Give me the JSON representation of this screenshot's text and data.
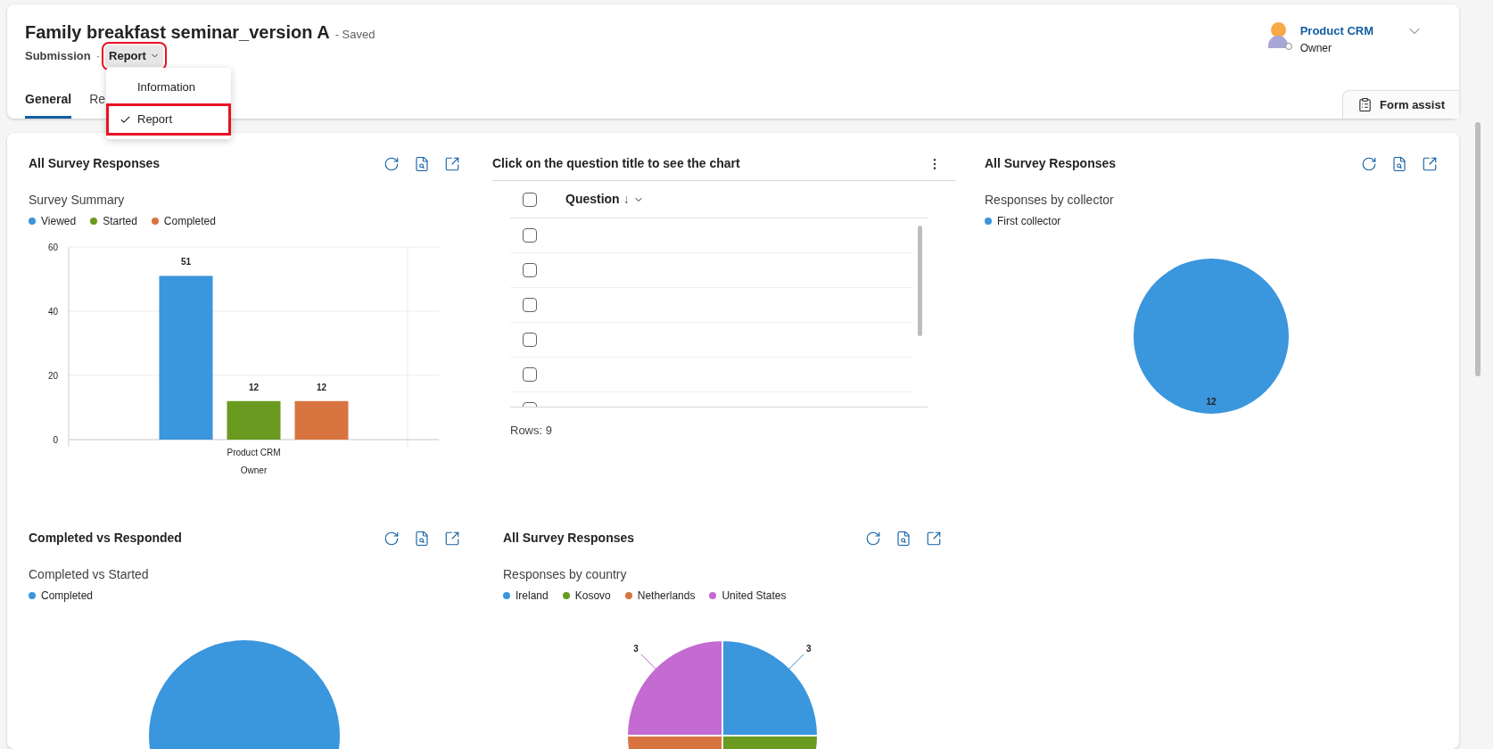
{
  "header": {
    "title": "Family breakfast seminar_version A",
    "save_status": "- Saved",
    "entity": "Submission",
    "separator": "·",
    "form_selector": {
      "label": "Report",
      "highlighted": true
    },
    "owner": {
      "name": "Product CRM",
      "role": "Owner"
    },
    "form_assist": "Form assist"
  },
  "tabs": [
    {
      "label": "General",
      "selected": true
    },
    {
      "label": "Re",
      "selected": false
    }
  ],
  "form_menu": [
    {
      "label": "Information",
      "selected": false,
      "highlighted": false
    },
    {
      "label": "Report",
      "selected": true,
      "highlighted": true
    }
  ],
  "tiles": [
    {
      "kind": "bar",
      "title": "All Survey Responses",
      "subtitle": "Survey Summary",
      "chart_data": {
        "type": "bar",
        "xlabel": "Owner",
        "categories": [
          "Product CRM"
        ],
        "series": [
          {
            "name": "Viewed",
            "color": "#3a96dd",
            "values": [
              51
            ]
          },
          {
            "name": "Started",
            "color": "#6a9a1f",
            "values": [
              12
            ]
          },
          {
            "name": "Completed",
            "color": "#d87440",
            "values": [
              12
            ]
          }
        ],
        "ylim": [
          0,
          60
        ],
        "yticks": [
          0,
          20,
          40,
          60
        ],
        "data_labels": true
      }
    },
    {
      "kind": "grid",
      "title": "Click on the question title to see the chart",
      "column": "Question",
      "sort_arrow": "↓",
      "select_all_checked": false,
      "rows": [
        {
          "checked": false
        },
        {
          "checked": false
        },
        {
          "checked": false
        },
        {
          "checked": false
        },
        {
          "checked": false
        },
        {
          "checked": false
        }
      ],
      "footer": "Rows: 9"
    },
    {
      "kind": "pie",
      "title": "All Survey Responses",
      "subtitle": "Responses by collector",
      "chart_data": {
        "type": "pie",
        "categories": [
          "First collector"
        ],
        "colors": [
          "#3a96dd"
        ],
        "series": [
          {
            "values": [
              12
            ]
          }
        ],
        "data_labels": true
      }
    },
    {
      "kind": "disc",
      "title": "Completed vs Responded",
      "subtitle": "Completed vs Started",
      "legend": [
        {
          "label": "Completed",
          "color": "#3a96dd"
        }
      ]
    },
    {
      "kind": "pie",
      "title": "All Survey Responses",
      "subtitle": "Responses by country",
      "chart_data": {
        "type": "pie",
        "categories": [
          "Ireland",
          "Kosovo",
          "Netherlands",
          "United States"
        ],
        "colors": [
          "#3a96dd",
          "#6a9a1f",
          "#d87440",
          "#c36bd1"
        ],
        "series": [
          {
            "values": [
              25,
              25,
              25,
              25
            ]
          }
        ],
        "value_labels": [
          "3",
          null,
          null,
          "3"
        ]
      }
    }
  ]
}
